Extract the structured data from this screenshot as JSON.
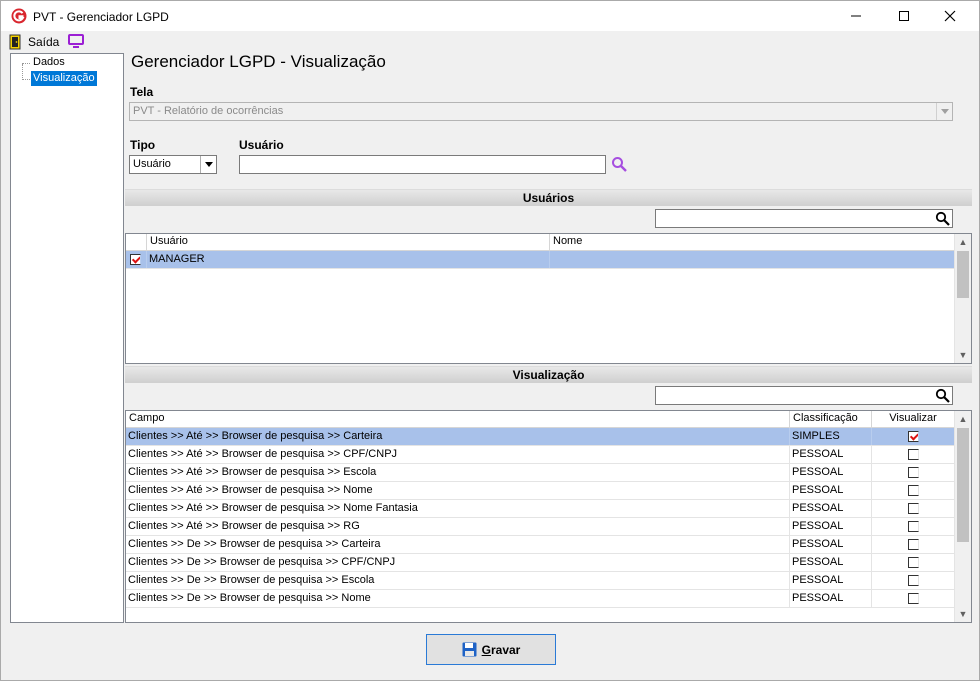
{
  "window": {
    "title": "PVT - Gerenciador LGPD"
  },
  "toolbar": {
    "exit_label": "Saída",
    "exit_icon": "exit-door-icon",
    "monitor_icon": "monitor-icon"
  },
  "tree": {
    "items": [
      {
        "label": "Dados",
        "selected": false
      },
      {
        "label": "Visualização",
        "selected": true
      }
    ]
  },
  "main": {
    "title": "Gerenciador LGPD - Visualização",
    "tela": {
      "label": "Tela",
      "value": "PVT - Relatório de ocorrências"
    },
    "tipo": {
      "label": "Tipo",
      "value": "Usuário"
    },
    "usuario": {
      "label": "Usuário",
      "value": ""
    }
  },
  "usuarios": {
    "section_title": "Usuários",
    "search_value": "",
    "columns": [
      "Usuário",
      "Nome"
    ],
    "rows": [
      {
        "checked": true,
        "usuario": "MANAGER",
        "nome": "",
        "selected": true
      }
    ]
  },
  "visualizacao": {
    "section_title": "Visualização",
    "search_value": "",
    "columns": [
      "Campo",
      "Classificação",
      "Visualizar"
    ],
    "rows": [
      {
        "campo": "Clientes >> Até >> Browser de pesquisa >> Carteira",
        "classificacao": "SIMPLES",
        "visualizar": true,
        "selected": true
      },
      {
        "campo": "Clientes >> Até >> Browser de pesquisa >> CPF/CNPJ",
        "classificacao": "PESSOAL",
        "visualizar": false
      },
      {
        "campo": "Clientes >> Até >> Browser de pesquisa >> Escola",
        "classificacao": "PESSOAL",
        "visualizar": false
      },
      {
        "campo": "Clientes >> Até >> Browser de pesquisa >> Nome",
        "classificacao": "PESSOAL",
        "visualizar": false
      },
      {
        "campo": "Clientes >> Até >> Browser de pesquisa >> Nome Fantasia",
        "classificacao": "PESSOAL",
        "visualizar": false
      },
      {
        "campo": "Clientes >> Até >> Browser de pesquisa >> RG",
        "classificacao": "PESSOAL",
        "visualizar": false
      },
      {
        "campo": "Clientes >> De >> Browser de pesquisa >> Carteira",
        "classificacao": "PESSOAL",
        "visualizar": false
      },
      {
        "campo": "Clientes >> De >> Browser de pesquisa >> CPF/CNPJ",
        "classificacao": "PESSOAL",
        "visualizar": false
      },
      {
        "campo": "Clientes >> De >> Browser de pesquisa >> Escola",
        "classificacao": "PESSOAL",
        "visualizar": false
      },
      {
        "campo": "Clientes >> De >> Browser de pesquisa >> Nome",
        "classificacao": "PESSOAL",
        "visualizar": false
      }
    ]
  },
  "footer": {
    "save_underlined": "G",
    "save_rest": "ravar"
  },
  "colors": {
    "selection_row": "#a8c1ea",
    "tree_selection": "#0078d7",
    "button_border": "#2a7ad6",
    "check_mark": "#dd1111"
  }
}
